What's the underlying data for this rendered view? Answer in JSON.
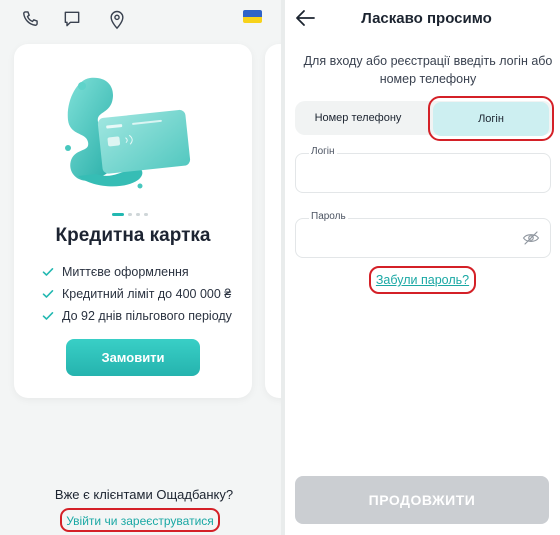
{
  "left": {
    "top_icons": [
      "phone-icon",
      "chat-icon",
      "location-pin-icon",
      "ukraine-flag-icon"
    ],
    "card": {
      "title": "Кредитна картка",
      "carousel": {
        "count": 4,
        "active": 1
      },
      "features": [
        "Миттєве оформлення",
        "Кредитний ліміт до 400 000 ₴",
        "До 92 днів пільгового періоду"
      ],
      "order_label": "Замовити"
    },
    "client_question": "Вже є клієнтами Ощадбанку?",
    "login_link": "Увійти чи зареєструватися"
  },
  "right": {
    "title": "Ласкаво просимо",
    "instruction": "Для входу або реєстрації введіть логін або номер телефону",
    "tabs": [
      {
        "label": "Номер телефону",
        "selected": false
      },
      {
        "label": "Логін",
        "selected": true
      }
    ],
    "fields": {
      "login_label": "Логін",
      "login_value": "",
      "password_label": "Пароль",
      "password_value": ""
    },
    "forgot_label": "Забули пароль?",
    "continue_label": "ПРОДОВЖИТИ"
  },
  "colors": {
    "accent": "#22b8b1",
    "highlight": "#d42027",
    "disabled": "#cbced2"
  }
}
